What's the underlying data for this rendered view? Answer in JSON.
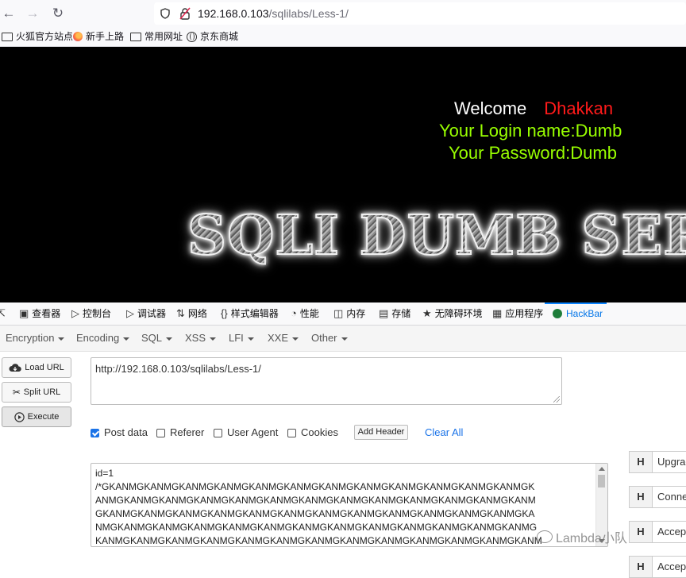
{
  "browser": {
    "url_host": "192.168.0.103",
    "url_path": "/sqlilabs/Less-1/",
    "bookmarks": [
      "火狐官方站点",
      "新手上路",
      "常用网址",
      "京东商城"
    ]
  },
  "page": {
    "welcome_label": "Welcome",
    "welcome_name": "Dhakkan",
    "login_line": "Your Login name:Dumb",
    "password_line": "Your Password:Dumb",
    "banner": "SQLI DUMB SERIES"
  },
  "devtools": {
    "tabs": [
      "查看器",
      "控制台",
      "调试器",
      "网络",
      "样式编辑器",
      "性能",
      "内存",
      "存储",
      "无障碍环境",
      "应用程序",
      "HackBar"
    ]
  },
  "hackbar": {
    "menu": [
      "Encryption",
      "Encoding",
      "SQL",
      "XSS",
      "LFI",
      "XXE",
      "Other"
    ],
    "buttons": {
      "load_url": "Load URL",
      "split_url": "Split URL",
      "execute": "Execute"
    },
    "url_value": "http://192.168.0.103/sqlilabs/Less-1/",
    "options": [
      {
        "label": "Post data",
        "checked": true
      },
      {
        "label": "Referer",
        "checked": false
      },
      {
        "label": "User Agent",
        "checked": false
      },
      {
        "label": "Cookies",
        "checked": false
      }
    ],
    "add_header": "Add Header",
    "clear_all": "Clear All",
    "post_lines": [
      "id=1",
      "/*GKANMGKANMGKANMGKANMGKANMGKANMGKANMGKANMGKANMGKANMGKANMGKANMGK",
      "ANMGKANMGKANMGKANMGKANMGKANMGKANMGKANMGKANMGKANMGKANMGKANMGKANM",
      "GKANMGKANMGKANMGKANMGKANMGKANMGKANMGKANMGKANMGKANMGKANMGKANMGKA",
      "NMGKANMGKANMGKANMGKANMGKANMGKANMGKANMGKANMGKANMGKANMGKANMGKANMG",
      "KANMGKANMGKANMGKANMGKANMGKANMGKANMGKANMGKANMGKANMGKANMGKANMGKANM"
    ],
    "headers": [
      {
        "h": "H",
        "name": "Upgrade"
      },
      {
        "h": "H",
        "name": "Connection"
      },
      {
        "h": "H",
        "name": "Accept"
      },
      {
        "h": "H",
        "name": "Accept"
      }
    ]
  },
  "watermark": "Lambda小队"
}
